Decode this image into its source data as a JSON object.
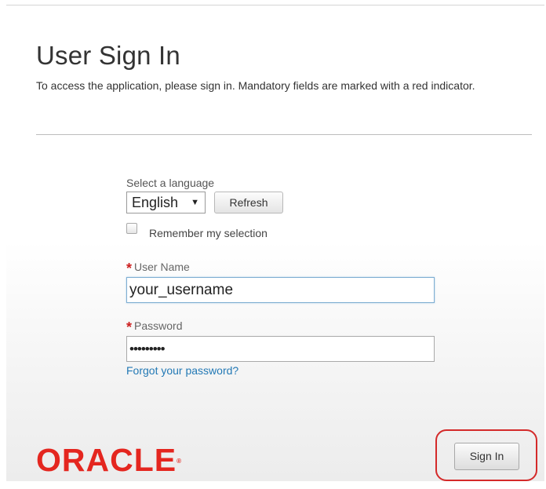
{
  "header": {
    "title": "User Sign In",
    "intro": "To access the application, please sign in. Mandatory fields are marked with a red indicator."
  },
  "language": {
    "label": "Select a language",
    "selected": "English",
    "refresh_label": "Refresh",
    "remember_label": "Remember my selection",
    "remember_checked": false
  },
  "login": {
    "required_marker": "*",
    "username_label": "User Name",
    "username_value": "your_username",
    "password_label": "Password",
    "password_value": "•••••••••",
    "forgot_link": "Forgot your password?"
  },
  "footer": {
    "logo_text": "ORACLE",
    "signin_label": "Sign In"
  },
  "colors": {
    "required": "#cc1f1f",
    "link": "#2379b5",
    "logo": "#e4261f",
    "highlight": "#d42a2a"
  }
}
